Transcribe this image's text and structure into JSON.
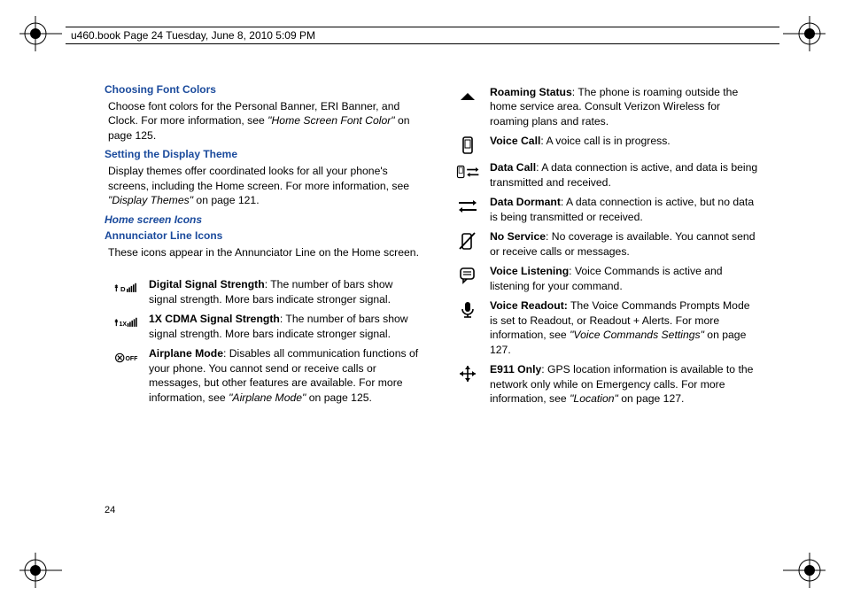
{
  "headerline": "u460.book  Page 24  Tuesday, June 8, 2010  5:09 PM",
  "page_number": "24",
  "left": {
    "h1": "Choosing Font Colors",
    "p1a": "Choose font colors for the Personal Banner, ERI Banner, and Clock. For more information, see ",
    "p1b": "\"Home Screen Font Color\"",
    "p1c": " on page 125.",
    "h2": "Setting the Display Theme",
    "p2a": "Display themes offer coordinated looks for all your phone's screens, including the Home screen. For more information, see ",
    "p2b": "\"Display Themes\"",
    "p2c": " on page 121.",
    "h3": "Home screen Icons",
    "h4": "Annunciator Line Icons",
    "p4": "These icons appear in the Annunciator Line on the Home screen.",
    "rows": {
      "r1": {
        "term": "Digital Signal Strength",
        "desc": ": The number of bars show signal strength. More bars indicate stronger signal."
      },
      "r2": {
        "term": "1X CDMA Signal Strength",
        "desc": ": The number of bars show signal strength. More bars indicate stronger signal."
      },
      "r3": {
        "term": "Airplane Mode",
        "desc_a": ": Disables all communication functions of your phone.  You cannot send or receive calls or messages, but other features are available. For more information, see ",
        "desc_b": "\"Airplane Mode\"",
        "desc_c": " on page 125."
      }
    }
  },
  "right": {
    "rows": {
      "r1": {
        "term": "Roaming Status",
        "desc": ": The phone is roaming outside the home service area. Consult Verizon Wireless for roaming plans and rates."
      },
      "r2": {
        "term": "Voice Call",
        "desc": ": A voice call is in progress."
      },
      "r3": {
        "term": "Data Call",
        "desc": ": A data connection is active, and data is being transmitted and received."
      },
      "r4": {
        "term": "Data Dormant",
        "desc": ": A data connection is active, but no data is being transmitted or received."
      },
      "r5": {
        "term": "No Service",
        "desc": ": No coverage is available. You cannot send or receive calls or messages."
      },
      "r6": {
        "term": "Voice Listening",
        "desc": ": Voice Commands is active and listening for your command."
      },
      "r7": {
        "term": "Voice Readout:",
        "desc_a": " The Voice Commands Prompts Mode is set to Readout, or Readout + Alerts. For more information, see ",
        "desc_b": "\"Voice Commands Settings\"",
        "desc_c": " on page 127."
      },
      "r8": {
        "term": "E911 Only",
        "desc_a": ": GPS location information is available to the network only while on Emergency calls. For more information, see ",
        "desc_b": "\"Location\"",
        "desc_c": " on page 127."
      }
    }
  }
}
